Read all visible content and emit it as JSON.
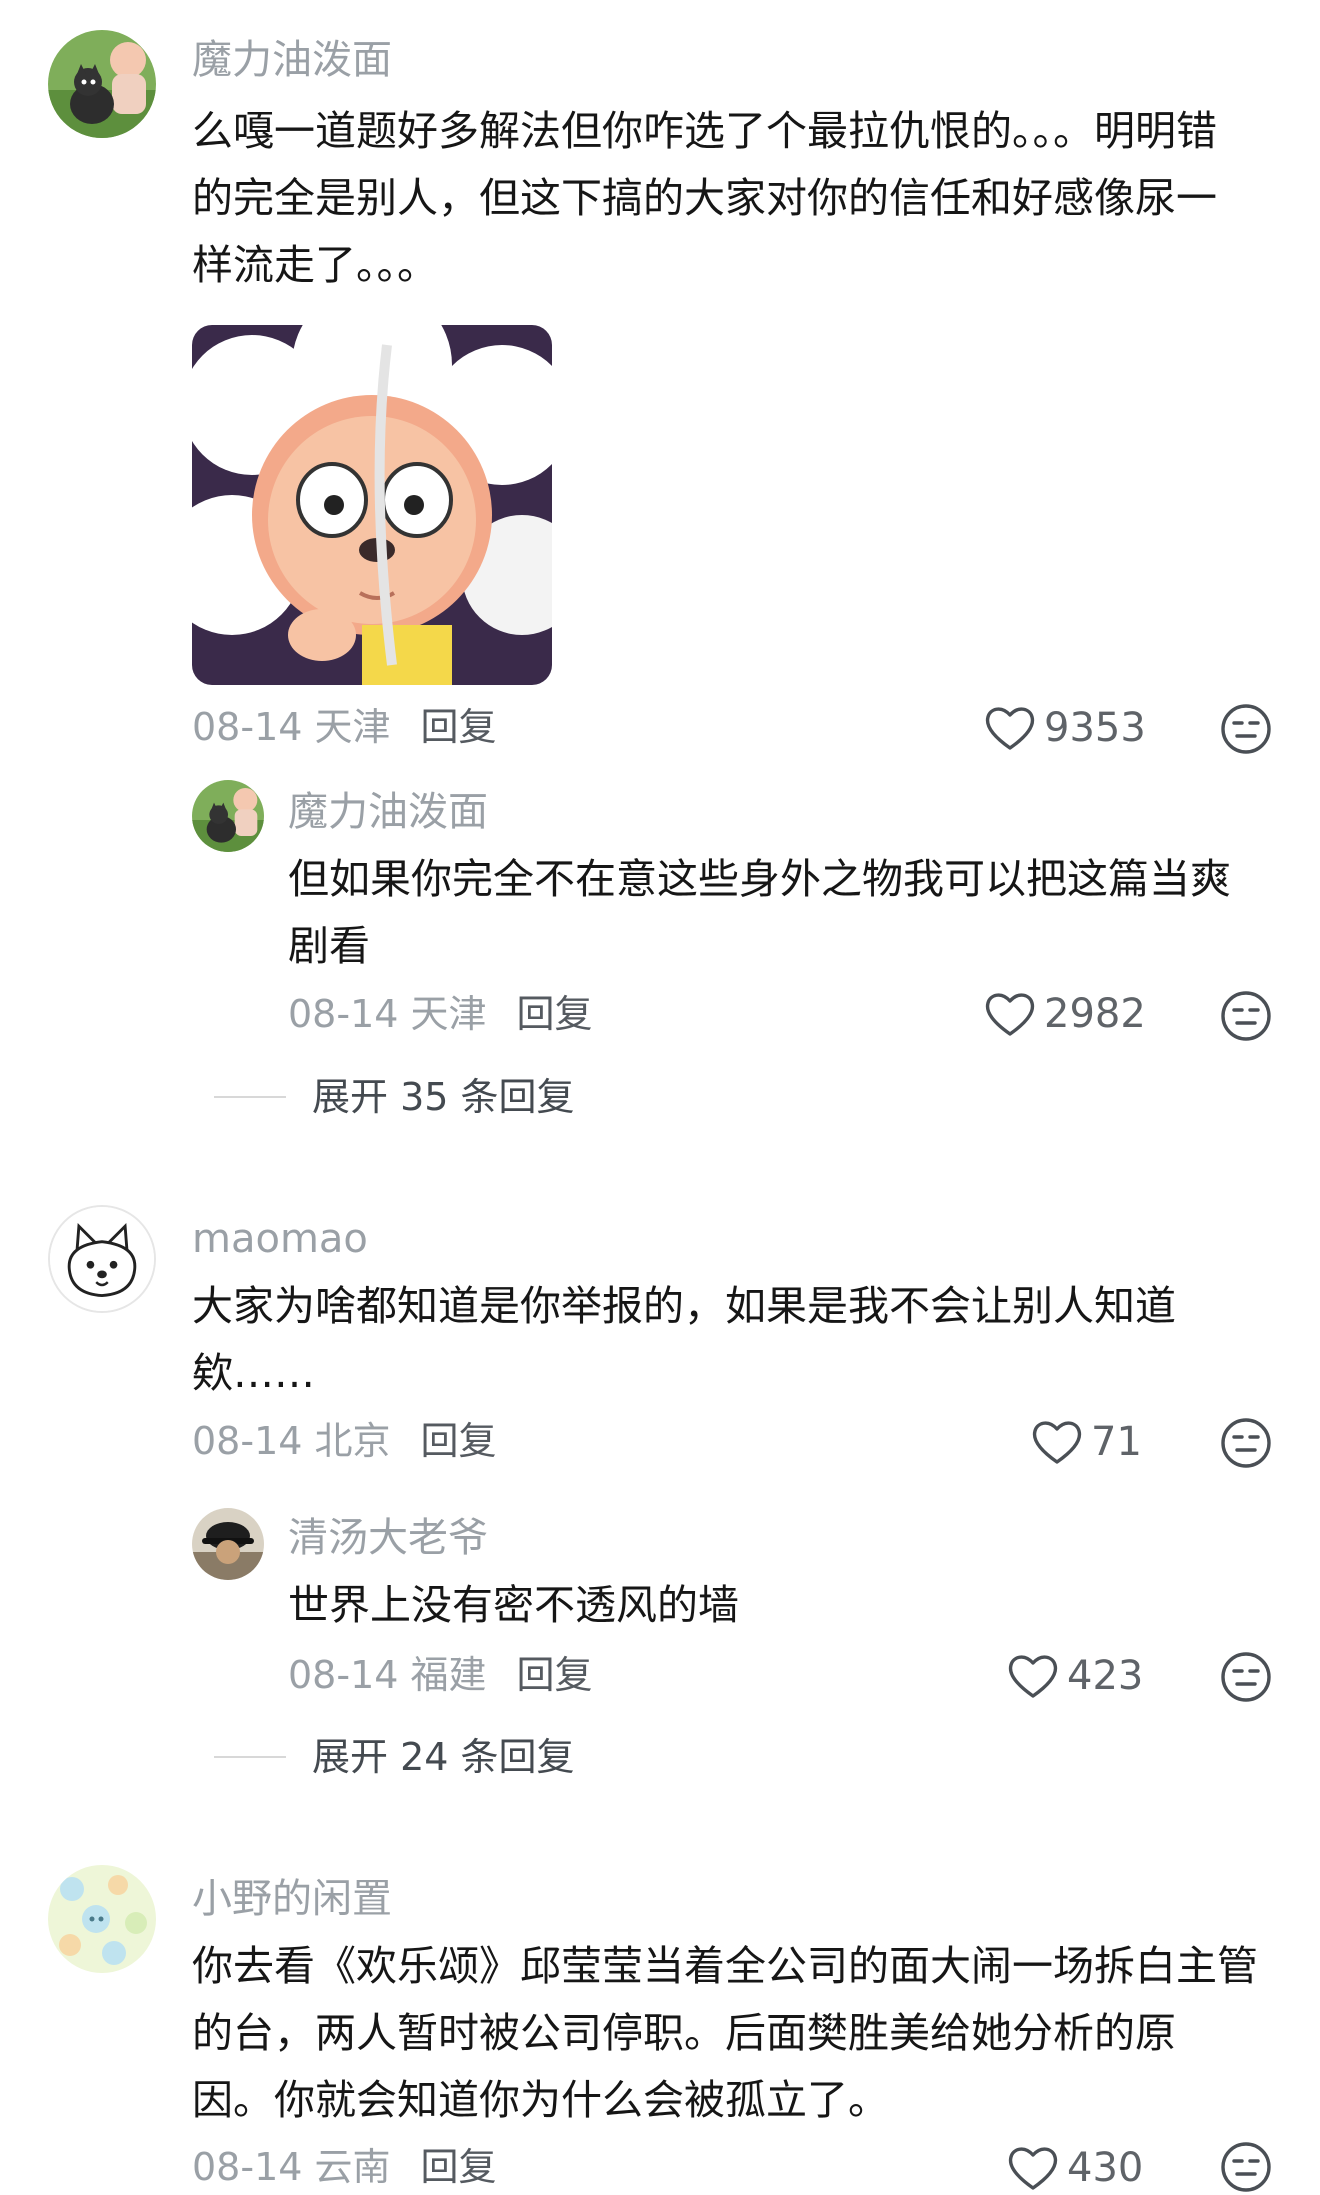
{
  "comments": [
    {
      "user": "魔力油泼面",
      "text_lines": [
        "么嘎一道题好多解法但你咋选了个最拉仇恨的。。。明明错",
        "的完全是别人，但这下搞的大家对你的信任和好感像尿一",
        "样流走了。。。"
      ],
      "sticker_icon": "sheep-face-sticker",
      "date_location": "08-14 天津",
      "reply_label": "回复",
      "likes": "9353",
      "replies": [
        {
          "user": "魔力油泼面",
          "text_lines": [
            "但如果你完全不在意这些身外之物我可以把这篇当爽",
            "剧看"
          ],
          "date_location": "08-14 天津",
          "reply_label": "回复",
          "likes": "2982"
        }
      ],
      "expand_label": "展开 35 条回复"
    },
    {
      "user": "maomao",
      "text_lines": [
        "大家为啥都知道是你举报的，如果是我不会让别人知道",
        "欸……"
      ],
      "date_location": "08-14 北京",
      "reply_label": "回复",
      "likes": "71",
      "replies": [
        {
          "user": "清汤大老爷",
          "text_lines": [
            "世界上没有密不透风的墙"
          ],
          "date_location": "08-14 福建",
          "reply_label": "回复",
          "likes": "423"
        }
      ],
      "expand_label": "展开 24 条回复"
    },
    {
      "user": "小野的闲置",
      "text_lines": [
        "你去看《欢乐颂》邱莹莹当着全公司的面大闹一场拆白主管",
        "的台，两人暂时被公司停职。后面樊胜美给她分析的原",
        "因。你就会知道你为什么会被孤立了。"
      ],
      "date_location": "08-14 云南",
      "reply_label": "回复",
      "likes": "430"
    }
  ],
  "icons": {
    "like": "heart-icon",
    "dislike": "dislike-face-icon",
    "avatar_1": "cartoon-cat-avatar",
    "avatar_2": "white-dog-avatar",
    "avatar_3": "cap-photo-avatar",
    "avatar_4": "pastel-pattern-avatar"
  },
  "colors": {
    "username": "#9aa0a6",
    "text": "#161616",
    "meta": "#9aa0a6",
    "icon": "#5f6368"
  }
}
